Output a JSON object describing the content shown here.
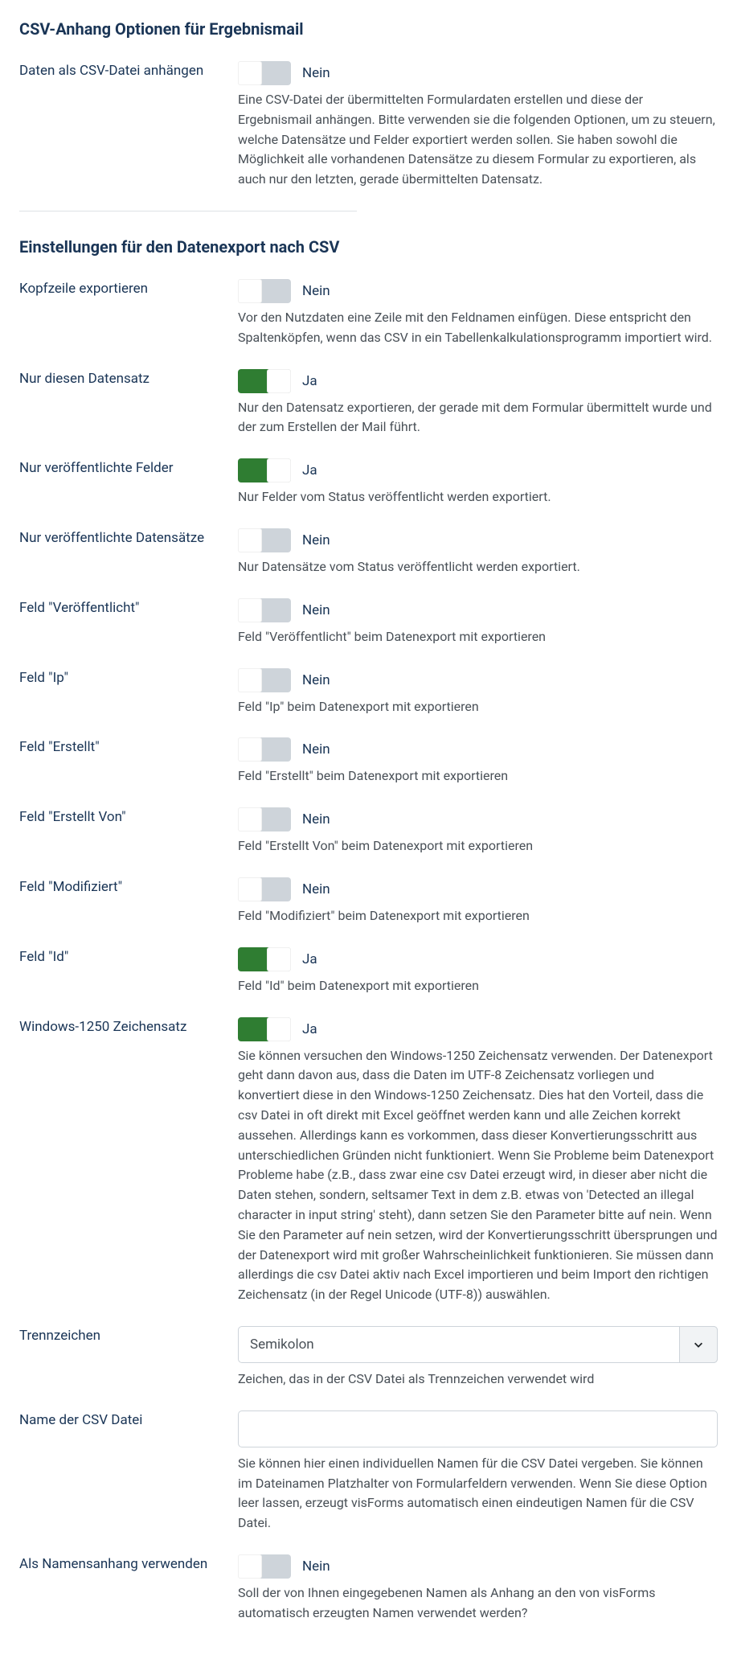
{
  "section1": {
    "title": "CSV-Anhang Optionen für Ergebnismail",
    "fields": [
      {
        "label": "Daten als CSV-Datei anhängen",
        "state": "off",
        "stateLabel": "Nein",
        "help": "Eine CSV-Datei der übermittelten Formulardaten erstellen und diese der Ergebnismail anhängen. Bitte verwenden sie die folgenden Optionen, um zu steuern, welche Datensätze und Felder exportiert werden sollen. Sie haben sowohl die Möglichkeit alle vorhandenen Datensätze zu diesem Formular zu exportieren, als auch nur den letzten, gerade übermittelten Datensatz."
      }
    ]
  },
  "section2": {
    "title": "Einstellungen für den Datenexport nach CSV",
    "fields": [
      {
        "label": "Kopfzeile exportieren",
        "state": "off",
        "stateLabel": "Nein",
        "help": "Vor den Nutzdaten eine Zeile mit den Feldnamen einfügen. Diese entspricht den Spaltenköpfen, wenn das CSV in ein Tabellenkalkulationsprogramm importiert wird."
      },
      {
        "label": "Nur diesen Datensatz",
        "state": "on",
        "stateLabel": "Ja",
        "help": "Nur den Datensatz exportieren, der gerade mit dem Formular übermittelt wurde und der zum Erstellen der Mail führt."
      },
      {
        "label": "Nur veröffentlichte Felder",
        "state": "on",
        "stateLabel": "Ja",
        "help": "Nur Felder vom Status veröffentlicht werden exportiert."
      },
      {
        "label": "Nur veröffentlichte Datensätze",
        "state": "off",
        "stateLabel": "Nein",
        "help": "Nur Datensätze vom Status veröffentlicht werden exportiert."
      },
      {
        "label": "Feld \"Veröffentlicht\"",
        "state": "off",
        "stateLabel": "Nein",
        "help": "Feld \"Veröffentlicht\" beim Datenexport mit exportieren"
      },
      {
        "label": "Feld \"Ip\"",
        "state": "off",
        "stateLabel": "Nein",
        "help": "Feld \"Ip\" beim Datenexport mit exportieren"
      },
      {
        "label": "Feld \"Erstellt\"",
        "state": "off",
        "stateLabel": "Nein",
        "help": "Feld \"Erstellt\" beim Datenexport mit exportieren"
      },
      {
        "label": "Feld \"Erstellt Von\"",
        "state": "off",
        "stateLabel": "Nein",
        "help": "Feld \"Erstellt Von\" beim Datenexport mit exportieren"
      },
      {
        "label": "Feld \"Modifiziert\"",
        "state": "off",
        "stateLabel": "Nein",
        "help": "Feld \"Modifiziert\" beim Datenexport mit exportieren"
      },
      {
        "label": "Feld \"Id\"",
        "state": "on",
        "stateLabel": "Ja",
        "help": "Feld \"Id\" beim Datenexport mit exportieren"
      },
      {
        "label": "Windows-1250 Zeichensatz",
        "state": "on",
        "stateLabel": "Ja",
        "help": "Sie können versuchen den Windows-1250 Zeichensatz verwenden. Der Datenexport geht dann davon aus, dass die Daten im UTF-8 Zeichensatz vorliegen und konvertiert diese in den Windows-1250 Zeichensatz. Dies hat den Vorteil, dass die csv Datei in oft direkt mit Excel geöffnet werden kann und alle Zeichen korrekt aussehen. Allerdings kann es vorkommen, dass dieser Konvertierungsschritt aus unterschiedlichen Gründen nicht funktioniert. Wenn Sie Probleme beim Datenexport Probleme habe (z.B., dass zwar eine csv Datei erzeugt wird, in dieser aber nicht die Daten stehen, sondern, seltsamer Text in dem z.B. etwas von 'Detected an illegal character in input string' steht), dann setzen Sie den Parameter bitte auf nein. Wenn Sie den Parameter auf nein setzen, wird der Konvertierungsschritt übersprungen und der Datenexport wird mit großer Wahrscheinlichkeit funktionieren. Sie müssen dann allerdings die csv Datei aktiv nach Excel importieren und beim Import den richtigen Zeichensatz (in der Regel Unicode (UTF-8)) auswählen."
      }
    ],
    "separator": {
      "label": "Trennzeichen",
      "value": "Semikolon",
      "help": "Zeichen, das in der CSV Datei als Trennzeichen verwendet wird"
    },
    "filename": {
      "label": "Name der CSV Datei",
      "value": "",
      "help": "Sie können hier einen individuellen Namen für die CSV Datei vergeben. Sie können im Dateinamen Platzhalter von Formularfeldern verwenden. Wenn Sie diese Option leer lassen, erzeugt visForms automatisch einen eindeutigen Namen für die CSV Datei."
    },
    "suffix": {
      "label": "Als Namensanhang verwenden",
      "state": "off",
      "stateLabel": "Nein",
      "help": "Soll der von Ihnen eingegebenen Namen als Anhang an den von visForms automatisch erzeugten Namen verwendet werden?"
    }
  }
}
